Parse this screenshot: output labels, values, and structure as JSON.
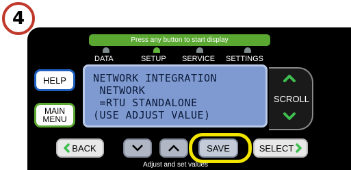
{
  "step_number": "4",
  "banner_text": "Press any button to start display",
  "tabs": [
    {
      "label": "DATA",
      "active": false
    },
    {
      "label": "SETUP",
      "active": true
    },
    {
      "label": "SERVICE",
      "active": false
    },
    {
      "label": "SETTINGS",
      "active": false
    }
  ],
  "lcd_lines": [
    "NETWORK INTEGRATION",
    " NETWORK",
    " =RTU STANDALONE",
    "(USE ADJUST VALUE)"
  ],
  "buttons": {
    "help": "HELP",
    "main_menu_line1": "MAIN",
    "main_menu_line2": "MENU",
    "scroll": "SCROLL",
    "back": "BACK",
    "save": "SAVE",
    "select": "SELECT"
  },
  "caption": "Adjust and set values",
  "colors": {
    "panel": "#000000",
    "banner": "#5aa832",
    "lcd": "#7f9ad0",
    "active_led": "#62b33e",
    "highlight": "#f2e600",
    "chevron_green": "#3fbf4f"
  },
  "icons": {
    "scroll_up": "chevron-up-icon",
    "scroll_down": "chevron-down-icon",
    "back": "chevron-left-icon",
    "select": "chevron-right-icon",
    "decrement": "chevron-down-icon",
    "increment": "chevron-up-icon"
  }
}
